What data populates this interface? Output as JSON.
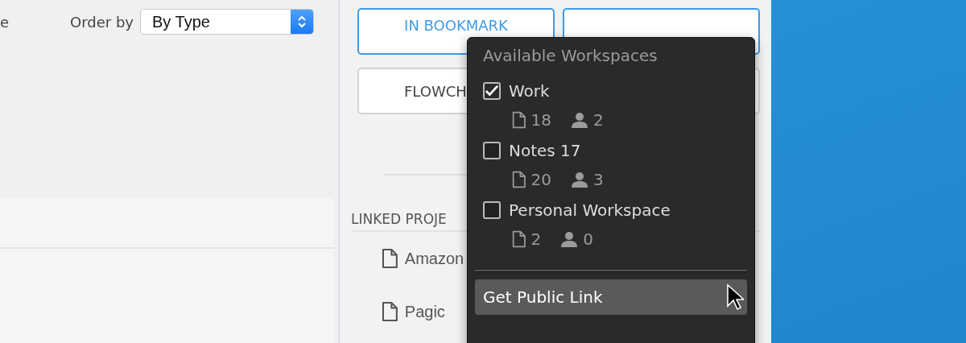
{
  "sort": {
    "cut_label": "e",
    "label": "Order by",
    "value": "By Type"
  },
  "actions": [
    {
      "label": "IN BOOKMARK",
      "kind": "primary"
    },
    {
      "label": "FLOWCH",
      "kind": "default"
    }
  ],
  "linked": {
    "heading": "LINKED PROJE",
    "items": [
      "Amazon",
      "Pagic"
    ]
  },
  "workspaces_menu": {
    "title": "Available Workspaces",
    "workspaces": [
      {
        "name": "Work",
        "checked": true,
        "documents": "18",
        "members": "2"
      },
      {
        "name": "Notes 17",
        "checked": false,
        "documents": "20",
        "members": "3"
      },
      {
        "name": "Personal Workspace",
        "checked": false,
        "documents": "2",
        "members": "0"
      }
    ],
    "action": {
      "label": "Get Public Link",
      "selected": true
    }
  }
}
